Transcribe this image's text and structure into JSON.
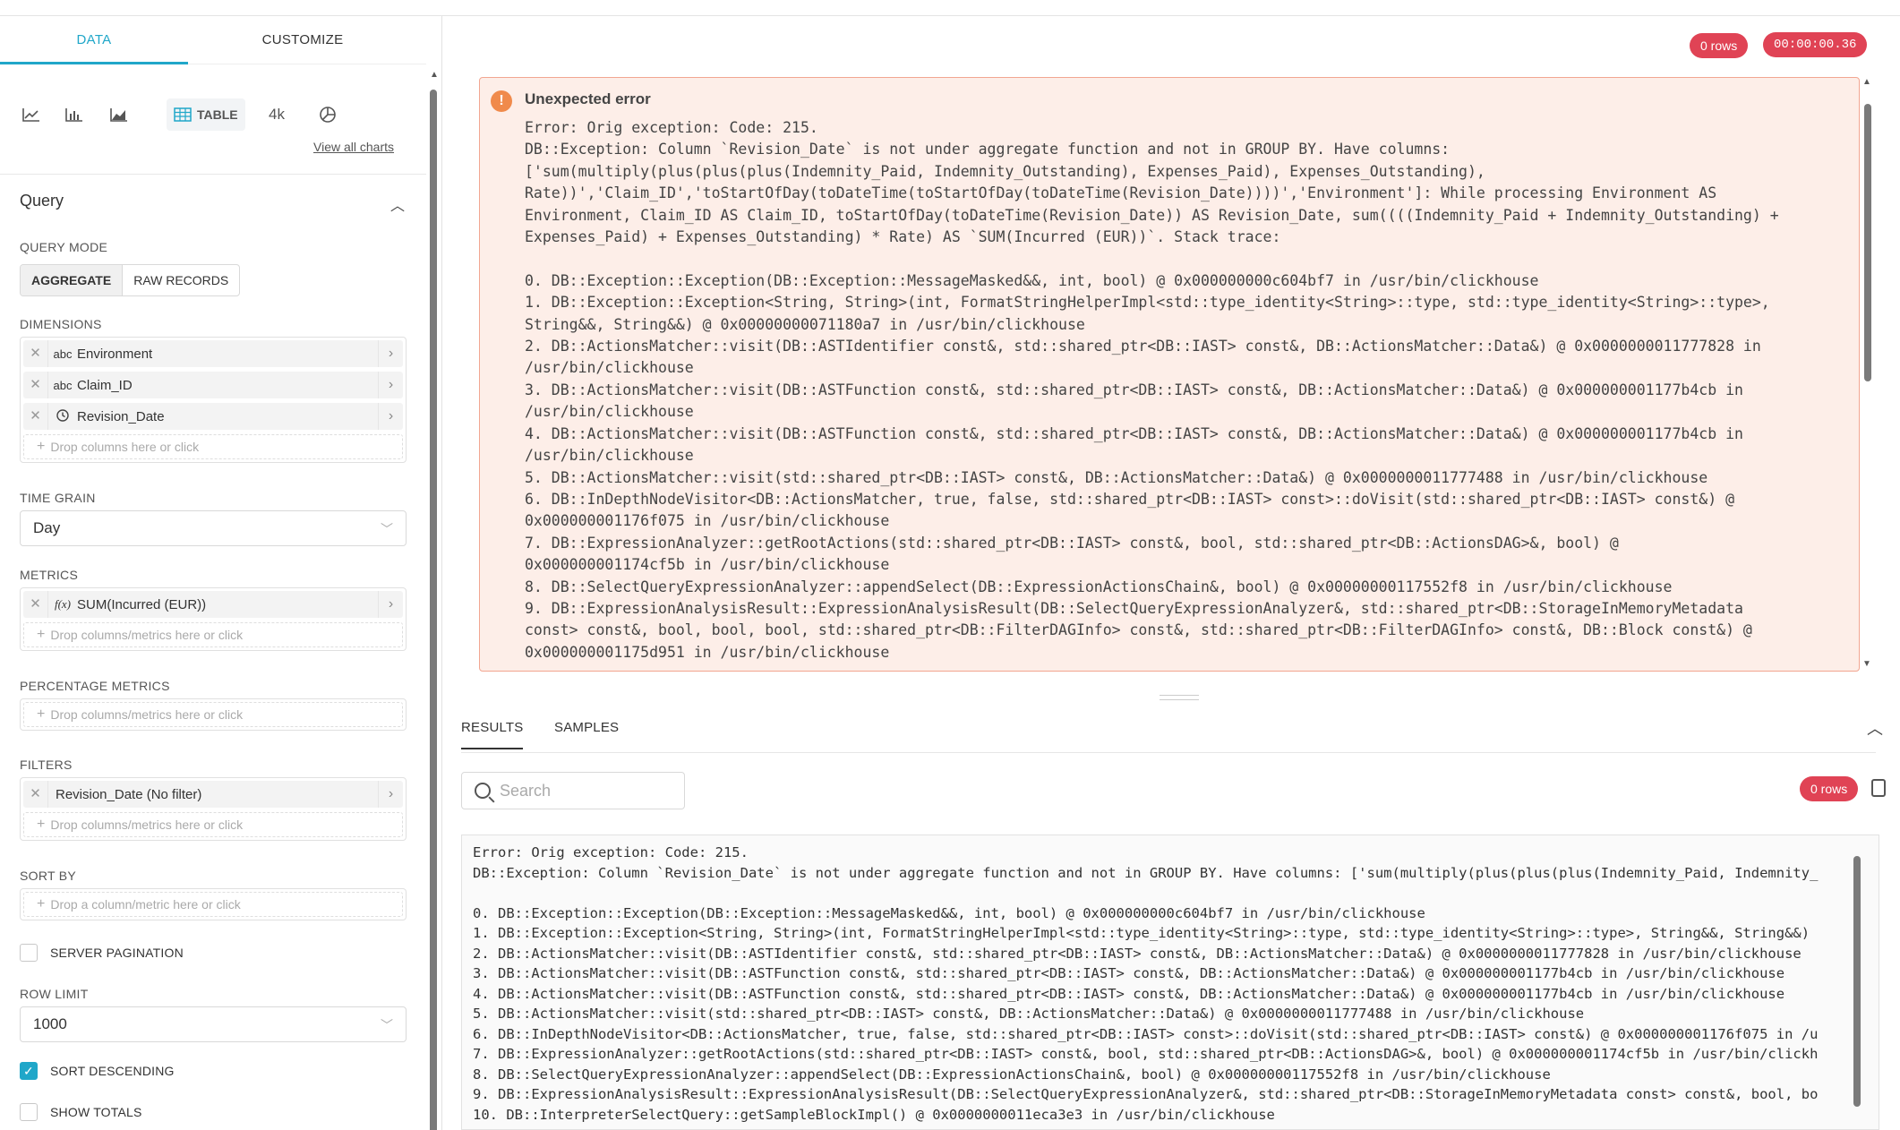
{
  "tabs": {
    "data": "DATA",
    "customize": "CUSTOMIZE"
  },
  "viz": {
    "table_label": "TABLE",
    "bignum_label": "4k",
    "view_all": "View all charts",
    "icons": [
      "line-chart-icon",
      "bar-chart-icon",
      "area-chart-icon",
      "table-icon",
      "big-number-icon",
      "pie-chart-icon"
    ]
  },
  "query": {
    "title": "Query",
    "mode_label": "QUERY MODE",
    "mode_aggregate": "AGGREGATE",
    "mode_raw": "RAW RECORDS",
    "dimensions_label": "DIMENSIONS",
    "dimensions": [
      {
        "type": "abc",
        "name": "Environment"
      },
      {
        "type": "abc",
        "name": "Claim_ID"
      },
      {
        "type": "clock-icon",
        "name": "Revision_Date"
      }
    ],
    "dimensions_drop": "Drop columns here or click",
    "time_grain_label": "TIME GRAIN",
    "time_grain": "Day",
    "metrics_label": "METRICS",
    "metrics": [
      {
        "type": "f(x)",
        "name": "SUM(Incurred (EUR))"
      }
    ],
    "metrics_drop": "Drop columns/metrics here or click",
    "pct_label": "PERCENTAGE METRICS",
    "pct_drop": "Drop columns/metrics here or click",
    "filters_label": "FILTERS",
    "filters": [
      {
        "name": "Revision_Date (No filter)"
      }
    ],
    "filters_drop": "Drop columns/metrics here or click",
    "sortby_label": "SORT BY",
    "sortby_drop": "Drop a column/metric here or click",
    "server_pagination": {
      "label": "SERVER PAGINATION",
      "checked": false
    },
    "row_limit_label": "ROW LIMIT",
    "row_limit": "1000",
    "sort_desc": {
      "label": "SORT DESCENDING",
      "checked": true
    },
    "show_totals": {
      "label": "SHOW TOTALS",
      "checked": false
    }
  },
  "status": {
    "rows": "0 rows",
    "timer": "00:00:00.36"
  },
  "error": {
    "title": "Unexpected error",
    "text": "Error: Orig exception: Code: 215.\nDB::Exception: Column `Revision_Date` is not under aggregate function and not in GROUP BY. Have columns:\n['sum(multiply(plus(plus(plus(Indemnity_Paid, Indemnity_Outstanding), Expenses_Paid), Expenses_Outstanding),\nRate))','Claim_ID','toStartOfDay(toDateTime(toStartOfDay(toDateTime(Revision_Date))))','Environment']: While processing Environment AS\nEnvironment, Claim_ID AS Claim_ID, toStartOfDay(toDateTime(Revision_Date)) AS Revision_Date, sum((((Indemnity_Paid + Indemnity_Outstanding) +\nExpenses_Paid) + Expenses_Outstanding) * Rate) AS `SUM(Incurred (EUR))`. Stack trace:\n\n0. DB::Exception::Exception(DB::Exception::MessageMasked&&, int, bool) @ 0x000000000c604bf7 in /usr/bin/clickhouse\n1. DB::Exception::Exception<String, String>(int, FormatStringHelperImpl<std::type_identity<String>::type, std::type_identity<String>::type>,\nString&&, String&&) @ 0x00000000071180a7 in /usr/bin/clickhouse\n2. DB::ActionsMatcher::visit(DB::ASTIdentifier const&, std::shared_ptr<DB::IAST> const&, DB::ActionsMatcher::Data&) @ 0x0000000011777828 in\n/usr/bin/clickhouse\n3. DB::ActionsMatcher::visit(DB::ASTFunction const&, std::shared_ptr<DB::IAST> const&, DB::ActionsMatcher::Data&) @ 0x000000001177b4cb in\n/usr/bin/clickhouse\n4. DB::ActionsMatcher::visit(DB::ASTFunction const&, std::shared_ptr<DB::IAST> const&, DB::ActionsMatcher::Data&) @ 0x000000001177b4cb in\n/usr/bin/clickhouse\n5. DB::ActionsMatcher::visit(std::shared_ptr<DB::IAST> const&, DB::ActionsMatcher::Data&) @ 0x0000000011777488 in /usr/bin/clickhouse\n6. DB::InDepthNodeVisitor<DB::ActionsMatcher, true, false, std::shared_ptr<DB::IAST> const>::doVisit(std::shared_ptr<DB::IAST> const&) @\n0x000000001176f075 in /usr/bin/clickhouse\n7. DB::ExpressionAnalyzer::getRootActions(std::shared_ptr<DB::IAST> const&, bool, std::shared_ptr<DB::ActionsDAG>&, bool) @\n0x000000001174cf5b in /usr/bin/clickhouse\n8. DB::SelectQueryExpressionAnalyzer::appendSelect(DB::ExpressionActionsChain&, bool) @ 0x00000000117552f8 in /usr/bin/clickhouse\n9. DB::ExpressionAnalysisResult::ExpressionAnalysisResult(DB::SelectQueryExpressionAnalyzer&, std::shared_ptr<DB::StorageInMemoryMetadata\nconst> const&, bool, bool, bool, std::shared_ptr<DB::FilterDAGInfo> const&, std::shared_ptr<DB::FilterDAGInfo> const&, DB::Block const&) @\n0x000000001175d951 in /usr/bin/clickhouse"
  },
  "results": {
    "tab_results": "RESULTS",
    "tab_samples": "SAMPLES",
    "search_placeholder": "Search",
    "rows": "0 rows",
    "text": "Error: Orig exception: Code: 215.\nDB::Exception: Column `Revision_Date` is not under aggregate function and not in GROUP BY. Have columns: ['sum(multiply(plus(plus(plus(Indemnity_Paid, Indemnity_\n\n0. DB::Exception::Exception(DB::Exception::MessageMasked&&, int, bool) @ 0x000000000c604bf7 in /usr/bin/clickhouse\n1. DB::Exception::Exception<String, String>(int, FormatStringHelperImpl<std::type_identity<String>::type, std::type_identity<String>::type>, String&&, String&&)\n2. DB::ActionsMatcher::visit(DB::ASTIdentifier const&, std::shared_ptr<DB::IAST> const&, DB::ActionsMatcher::Data&) @ 0x0000000011777828 in /usr/bin/clickhouse\n3. DB::ActionsMatcher::visit(DB::ASTFunction const&, std::shared_ptr<DB::IAST> const&, DB::ActionsMatcher::Data&) @ 0x000000001177b4cb in /usr/bin/clickhouse\n4. DB::ActionsMatcher::visit(DB::ASTFunction const&, std::shared_ptr<DB::IAST> const&, DB::ActionsMatcher::Data&) @ 0x000000001177b4cb in /usr/bin/clickhouse\n5. DB::ActionsMatcher::visit(std::shared_ptr<DB::IAST> const&, DB::ActionsMatcher::Data&) @ 0x0000000011777488 in /usr/bin/clickhouse\n6. DB::InDepthNodeVisitor<DB::ActionsMatcher, true, false, std::shared_ptr<DB::IAST> const>::doVisit(std::shared_ptr<DB::IAST> const&) @ 0x000000001176f075 in /u\n7. DB::ExpressionAnalyzer::getRootActions(std::shared_ptr<DB::IAST> const&, bool, std::shared_ptr<DB::ActionsDAG>&, bool) @ 0x000000001174cf5b in /usr/bin/clickh\n8. DB::SelectQueryExpressionAnalyzer::appendSelect(DB::ExpressionActionsChain&, bool) @ 0x00000000117552f8 in /usr/bin/clickhouse\n9. DB::ExpressionAnalysisResult::ExpressionAnalysisResult(DB::SelectQueryExpressionAnalyzer&, std::shared_ptr<DB::StorageInMemoryMetadata const> const&, bool, bo\n10. DB::InterpreterSelectQuery::getSampleBlockImpl() @ 0x0000000011eca3e3 in /usr/bin/clickhouse"
  },
  "colors": {
    "accent": "#20a7c9",
    "badge": "#e04355",
    "error_bg": "#fdeee8",
    "error_border": "#f2a691"
  }
}
